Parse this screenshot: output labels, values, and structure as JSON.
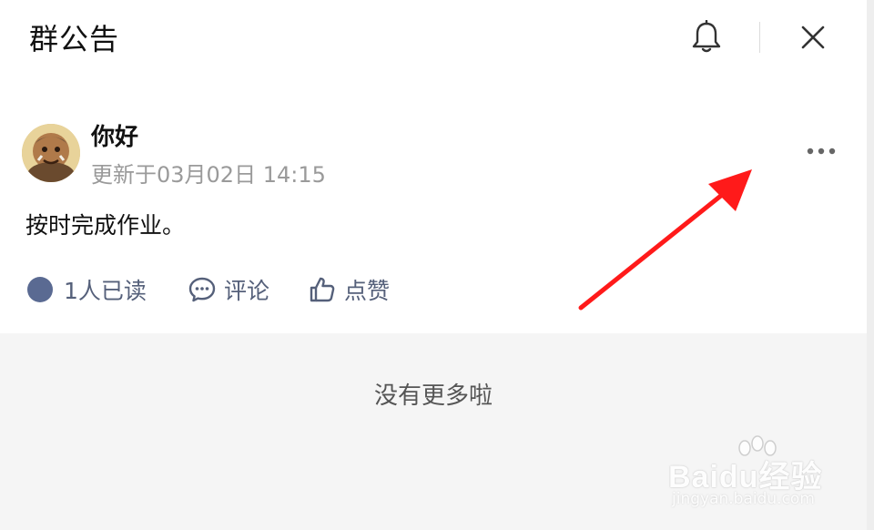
{
  "header": {
    "title": "群公告",
    "bell_icon": "bell-icon",
    "close_icon": "close-icon"
  },
  "post": {
    "author": "你好",
    "updated": "更新于03月02日 14:15",
    "content": "按时完成作业。",
    "more_icon": "more-icon",
    "actions": {
      "read_label": "1人已读",
      "comment_label": "评论",
      "like_label": "点赞"
    }
  },
  "footer": {
    "no_more": "没有更多啦"
  },
  "watermark": {
    "brand": "Baidu经验",
    "url": "jingyan.baidu.com"
  },
  "colors": {
    "accent": "#5a6a92",
    "arrow": "#ff1a1a",
    "footer_bg": "#f5f5f5"
  }
}
